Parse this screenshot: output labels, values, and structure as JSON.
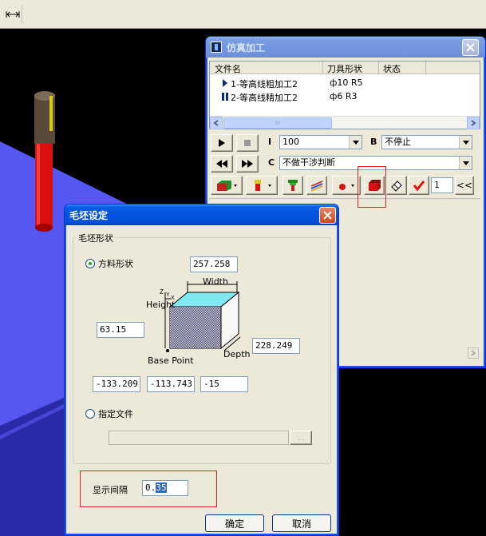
{
  "toolbar": {
    "fit_icon": "fit-width-icon"
  },
  "sim_window": {
    "title": "仿真加工",
    "columns": [
      "文件名",
      "刀具形状",
      "状态"
    ],
    "rows": [
      {
        "marker": "play",
        "name": "1-等高线粗加工2",
        "tool": "ф10 R5",
        "status": ""
      },
      {
        "marker": "pause",
        "name": "2-等高线精加工2",
        "tool": "ф6 R3",
        "status": ""
      }
    ],
    "hscroll_grip": "III",
    "label_i": "I",
    "speed_value": "100",
    "label_b": "B",
    "stop_value": "不停止",
    "label_c": "C",
    "collision_value": "不做干涉判断",
    "step_value": "1",
    "collapse_label": "<<"
  },
  "blank_dialog": {
    "title": "毛坯设定",
    "group_label": "毛坯形状",
    "option_box": "方料形状",
    "option_file": "指定文件",
    "width_value": "257.258",
    "height_value": "63.15",
    "depth_value": "228.249",
    "base_x": "-133.209",
    "base_y": "-113.743",
    "base_z": "-15",
    "diagram": {
      "width_label": "Width",
      "height_label": "Height",
      "depth_label": "Depth",
      "base_label": "Base Point",
      "axis_z": "Z",
      "axis_y": "Y",
      "axis_x": "X"
    },
    "file_path": "",
    "browse_label": "...",
    "interval_label": "显示间隔",
    "interval_value_plain": "0.",
    "interval_value_selected": "35",
    "ok_label": "确定",
    "cancel_label": "取消"
  }
}
